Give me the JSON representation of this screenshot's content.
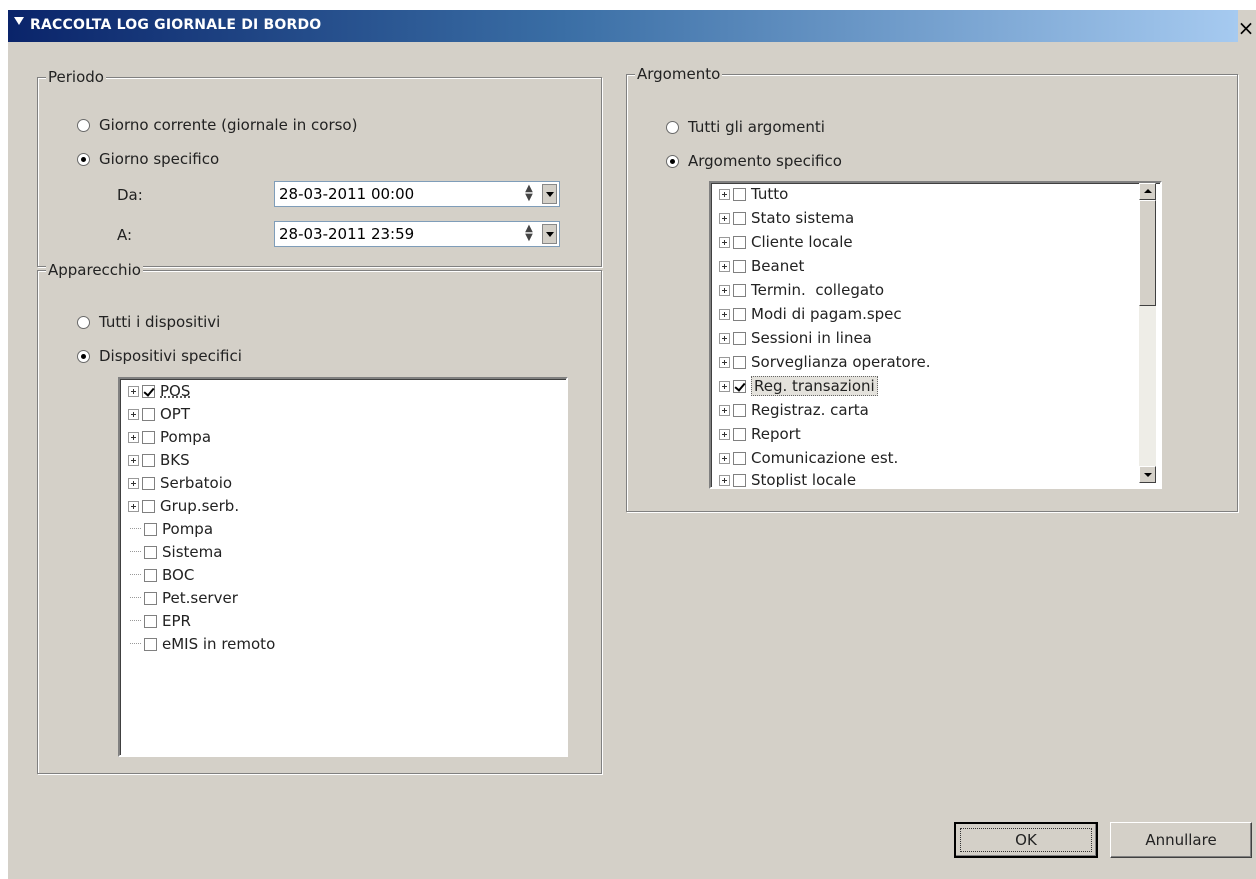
{
  "window": {
    "title": "RACCOLTA LOG GIORNALE DI BORDO",
    "close_label": "×"
  },
  "periodo": {
    "legend": "Periodo",
    "option_current": "Giorno corrente (giornale in corso)",
    "option_specific": "Giorno specifico",
    "selected": "specific",
    "from_label": "Da:",
    "from_value": "28-03-2011 00:00",
    "to_label": "A:",
    "to_value": "28-03-2011 23:59"
  },
  "apparecchio": {
    "legend": "Apparecchio",
    "option_all": "Tutti i dispositivi",
    "option_specific": "Dispositivi specifici",
    "selected": "specific",
    "items": [
      {
        "label": "POS",
        "expandable": true,
        "checked": true,
        "focused": false
      },
      {
        "label": "OPT",
        "expandable": true,
        "checked": false
      },
      {
        "label": "Pompa",
        "expandable": true,
        "checked": false
      },
      {
        "label": "BKS",
        "expandable": true,
        "checked": false
      },
      {
        "label": "Serbatoio",
        "expandable": true,
        "checked": false
      },
      {
        "label": "Grup.serb.",
        "expandable": true,
        "checked": false
      },
      {
        "label": "Pompa",
        "expandable": false,
        "checked": false
      },
      {
        "label": "Sistema",
        "expandable": false,
        "checked": false
      },
      {
        "label": "BOC",
        "expandable": false,
        "checked": false
      },
      {
        "label": "Pet.server",
        "expandable": false,
        "checked": false
      },
      {
        "label": "EPR",
        "expandable": false,
        "checked": false
      },
      {
        "label": "eMIS in remoto",
        "expandable": false,
        "checked": false
      }
    ]
  },
  "argomento": {
    "legend": "Argomento",
    "option_all": "Tutti gli argomenti",
    "option_specific": "Argomento specifico",
    "selected": "specific",
    "items": [
      {
        "label": "Tutto",
        "checked": false
      },
      {
        "label": "Stato sistema",
        "checked": false
      },
      {
        "label": "Cliente locale",
        "checked": false
      },
      {
        "label": "Beanet",
        "checked": false
      },
      {
        "label": "Termin.  collegato",
        "checked": false
      },
      {
        "label": "Modi di pagam.spec",
        "checked": false
      },
      {
        "label": "Sessioni in linea",
        "checked": false
      },
      {
        "label": "Sorveglianza operatore.",
        "checked": false
      },
      {
        "label": "Reg. transazioni",
        "checked": true,
        "selected": true
      },
      {
        "label": "Registraz. carta",
        "checked": false
      },
      {
        "label": "Report",
        "checked": false
      },
      {
        "label": "Comunicazione est.",
        "checked": false
      },
      {
        "label": "Stoplist locale",
        "checked": false
      }
    ],
    "scroll_position": 0.0
  },
  "buttons": {
    "ok": "OK",
    "cancel": "Annullare"
  }
}
